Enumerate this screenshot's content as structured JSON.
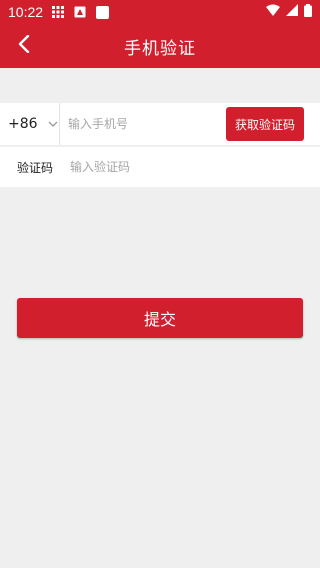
{
  "status_bar": {
    "time": "10:22",
    "icons": [
      "grid-icon",
      "image-notification-icon",
      "square-notification-icon",
      "wifi-icon",
      "signal-icon",
      "battery-icon"
    ]
  },
  "header": {
    "title": "手机验证",
    "back_icon": "chevron-left-icon"
  },
  "phone_row": {
    "country_code": "+86",
    "phone_placeholder": "输入手机号",
    "get_code_label": "获取验证码"
  },
  "code_row": {
    "label": "验证码",
    "placeholder": "输入验证码"
  },
  "submit": {
    "label": "提交"
  },
  "colors": {
    "primary": "#d11f2d",
    "background": "#efefef"
  }
}
